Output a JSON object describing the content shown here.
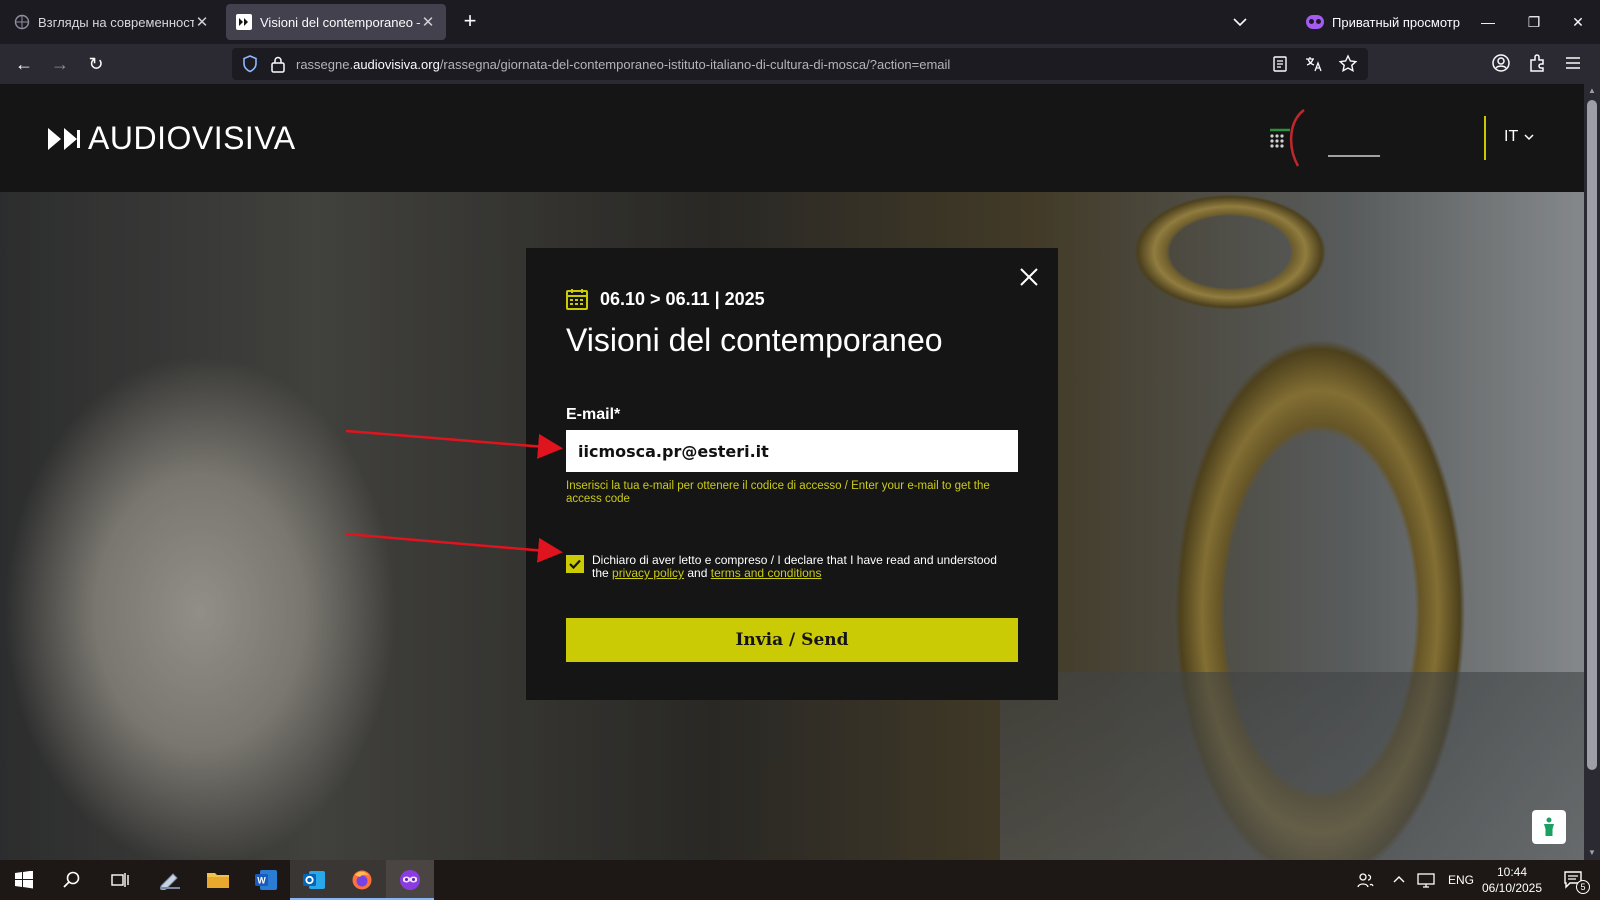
{
  "browser": {
    "tabs": [
      {
        "title": "Взгляды на современность: он"
      },
      {
        "title": "Visioni del contemporaneo – Au"
      }
    ],
    "private_label": "Приватный просмотр",
    "url_prefix": "rassegne.",
    "url_domain": "audiovisiva.org",
    "url_path": "/rassegna/giornata-del-contemporaneo-istituto-italiano-di-cultura-di-mosca/?action=email"
  },
  "header": {
    "logo_text": "AUDIOVISIVA",
    "lang": "IT"
  },
  "modal": {
    "dates": "06.10 > 06.11 | 2025",
    "title": "Visioni del contemporaneo",
    "email_label": "E-mail*",
    "email_value": "iicmosca.pr@esteri.it",
    "email_hint": "Inserisci la tua e-mail per ottenere il codice di accesso / Enter your e-mail to get the access code",
    "consent_text": "Dichiaro di aver letto e compreso / I declare that I have read and understood the ",
    "privacy_link": "privacy policy",
    "and_text": " and ",
    "terms_link": "terms and conditions",
    "consent_checked": true,
    "send_label": "Invia / Send"
  },
  "taskbar": {
    "lang": "ENG",
    "time": "10:44",
    "date": "06/10/2025",
    "notifications": "5"
  },
  "colors": {
    "accent": "#cbcb05",
    "annotation_arrow": "#e0141e",
    "modal_bg": "#151515",
    "browser_bg": "#1c1b22"
  }
}
